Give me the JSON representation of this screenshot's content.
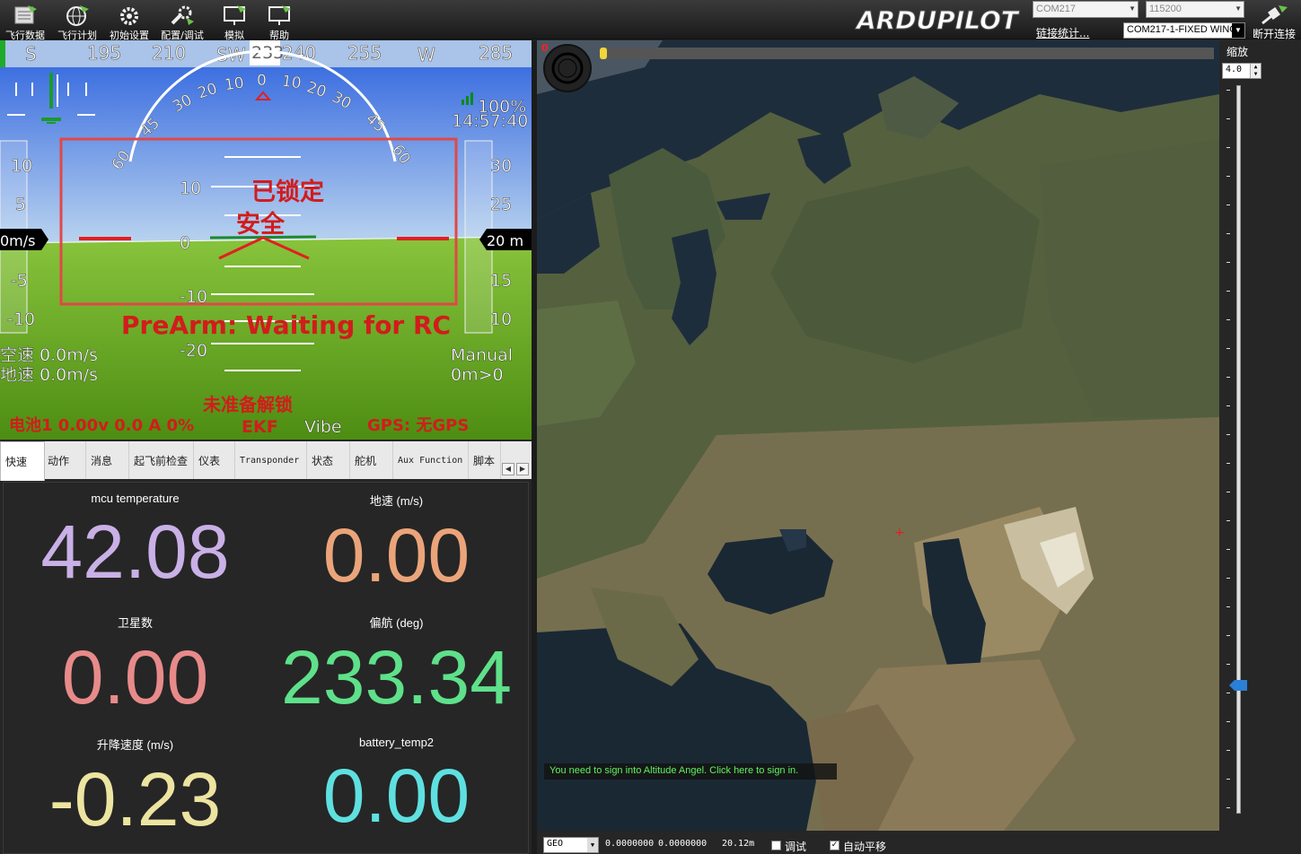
{
  "toolbar": {
    "buttons": [
      {
        "label": "飞行数据",
        "icon": "flight-data-icon"
      },
      {
        "label": "飞行计划",
        "icon": "globe-icon"
      },
      {
        "label": "初始设置",
        "icon": "gear-icon"
      },
      {
        "label": "配置/调试",
        "icon": "wrench-icon"
      },
      {
        "label": "模拟",
        "icon": "monitor-plane-icon"
      },
      {
        "label": "帮助",
        "icon": "monitor-help-icon"
      }
    ],
    "logo_text": "ARDUPILOT",
    "port_combo": "COM217",
    "baud_combo": "115200",
    "link_stats": "链接统计...",
    "vehicle_combo": "COM217-1-FIXED WING",
    "connect_label": "断开连接"
  },
  "hud": {
    "heading_tape": [
      "S",
      "195",
      "210",
      "SW",
      "233",
      "240",
      "255",
      "W",
      "285"
    ],
    "heading_current": "233",
    "roll_scale": [
      "60",
      "45",
      "30",
      "20",
      "10",
      "0",
      "10",
      "20",
      "30",
      "45",
      "60"
    ],
    "pitch_scale": [
      "10",
      "0",
      "-10",
      "-20"
    ],
    "speed_scale": [
      "10",
      "5",
      "-5",
      "-10"
    ],
    "speed_current": "0m/s",
    "alt_scale": [
      "30",
      "25",
      "15",
      "10"
    ],
    "alt_current": "20 m",
    "link_quality": "100%",
    "clock": "14:57:40",
    "armed_status": "已锁定",
    "safety_status": "安全",
    "prearm_message": "PreArm: Waiting for RC",
    "airspeed": "空速 0.0m/s",
    "groundspeed": "地速 0.0m/s",
    "flight_mode": "Manual",
    "wp_dist": "0m>0",
    "not_ready": "未准备解锁",
    "battery": "电池1 0.00v 0.0 A 0%",
    "ekf": "EKF",
    "vibe": "Vibe",
    "gps": "GPS: 无GPS"
  },
  "tabs": [
    {
      "label": "快速",
      "active": true
    },
    {
      "label": "动作"
    },
    {
      "label": "消息"
    },
    {
      "label": "起飞前检查"
    },
    {
      "label": "仪表"
    },
    {
      "label": "Transponder"
    },
    {
      "label": "状态"
    },
    {
      "label": "舵机"
    },
    {
      "label": "Aux Function"
    },
    {
      "label": "脚本"
    }
  ],
  "quick": [
    {
      "label": "mcu temperature",
      "value": "42.08",
      "color": "#c9b0e6"
    },
    {
      "label": "地速 (m/s)",
      "value": "0.00",
      "color": "#eba47a"
    },
    {
      "label": "卫星数",
      "value": "0.00",
      "color": "#e88a8a"
    },
    {
      "label": "偏航 (deg)",
      "value": "233.34",
      "color": "#5fe08a"
    },
    {
      "label": "升降速度 (m/s)",
      "value": "-0.23",
      "color": "#ece4a0"
    },
    {
      "label": "battery_temp2",
      "value": "0.00",
      "color": "#5fe0e0"
    }
  ],
  "map": {
    "counter": "0",
    "altitude_angel_banner": "You need to sign into Altitude Angel. Click here to sign in.",
    "zoom_label": "缩放",
    "zoom_value": "4.0",
    "zoom_level_fraction": 0.83
  },
  "status": {
    "coord_system": "GEO",
    "lat": "0.0000000",
    "lng": "0.0000000",
    "alt": "20.12m",
    "debug_label": "调试",
    "debug_checked": false,
    "autopan_label": "自动平移",
    "autopan_checked": true
  }
}
